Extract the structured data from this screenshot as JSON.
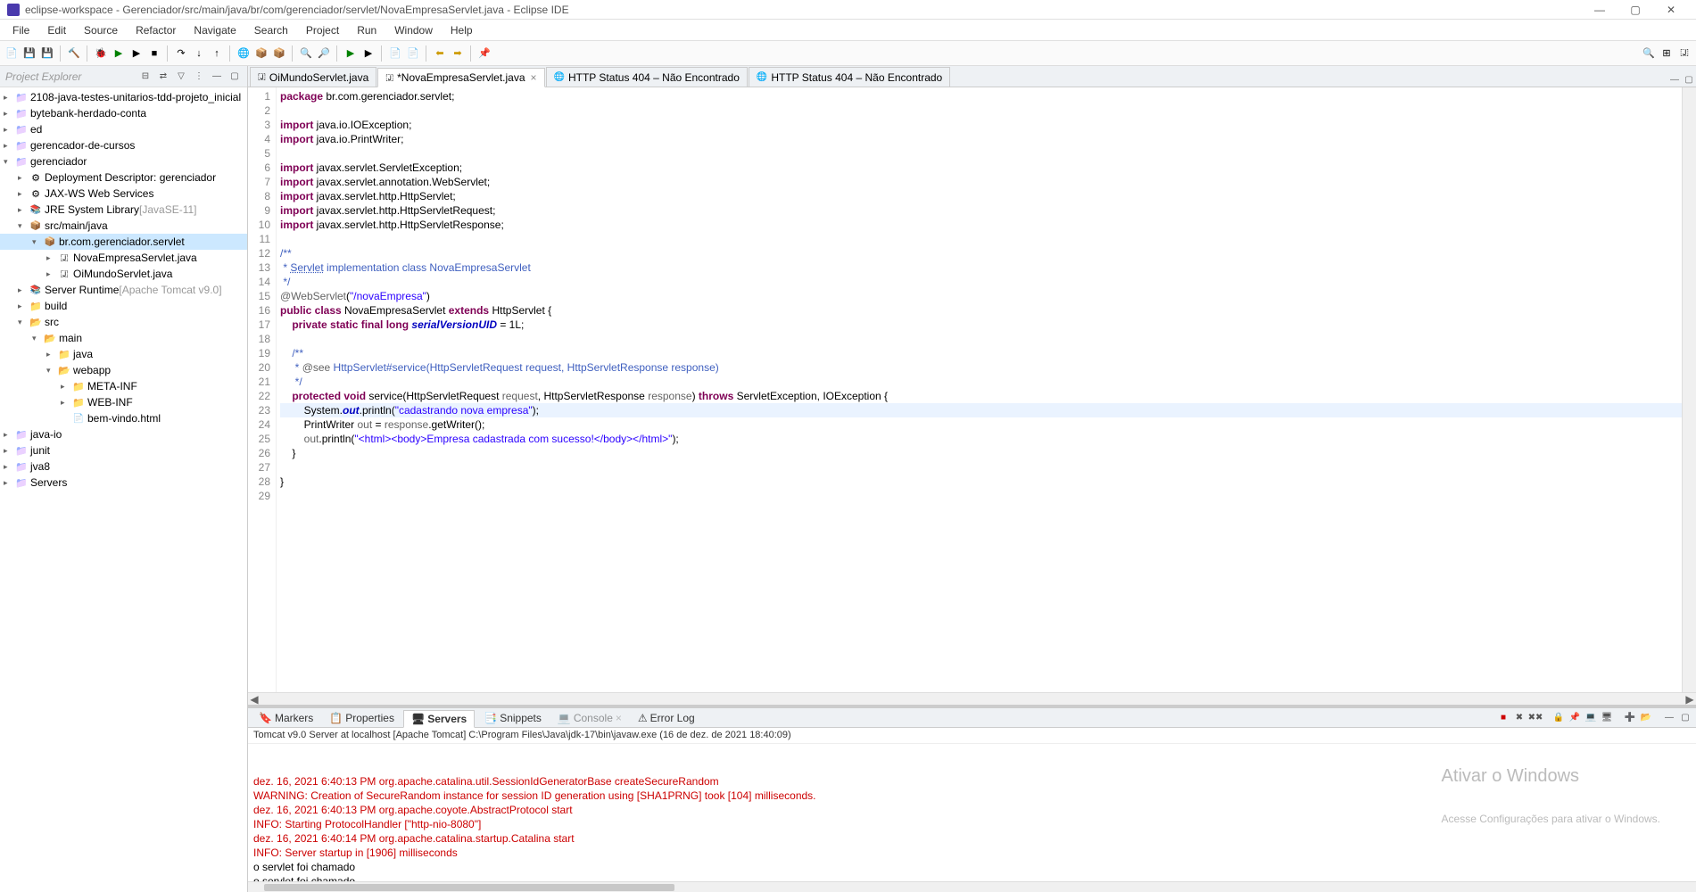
{
  "title": "eclipse-workspace - Gerenciador/src/main/java/br/com/gerenciador/servlet/NovaEmpresaServlet.java - Eclipse IDE",
  "menu": [
    "File",
    "Edit",
    "Source",
    "Refactor",
    "Navigate",
    "Search",
    "Project",
    "Run",
    "Window",
    "Help"
  ],
  "sidebar_title": "Project Explorer",
  "tree": [
    {
      "d": 0,
      "c": ">",
      "i": "proj",
      "t": "2108-java-testes-unitarios-tdd-projeto_inicial"
    },
    {
      "d": 0,
      "c": ">",
      "i": "proj",
      "t": "bytebank-herdado-conta"
    },
    {
      "d": 0,
      "c": ">",
      "i": "proj",
      "t": "ed"
    },
    {
      "d": 0,
      "c": ">",
      "i": "proj",
      "t": "gerencador-de-cursos"
    },
    {
      "d": 0,
      "c": "v",
      "i": "proj",
      "t": "gerenciador"
    },
    {
      "d": 1,
      "c": ">",
      "i": "gear",
      "t": "Deployment Descriptor: gerenciador"
    },
    {
      "d": 1,
      "c": ">",
      "i": "gear",
      "t": "JAX-WS Web Services"
    },
    {
      "d": 1,
      "c": ">",
      "i": "jar",
      "t": "JRE System Library",
      "suf": "[JavaSE-11]"
    },
    {
      "d": 1,
      "c": "v",
      "i": "pkg",
      "t": "src/main/java"
    },
    {
      "d": 2,
      "c": "v",
      "i": "pkg",
      "t": "br.com.gerenciador.servlet",
      "sel": true
    },
    {
      "d": 3,
      "c": ">",
      "i": "file-j",
      "t": "NovaEmpresaServlet.java"
    },
    {
      "d": 3,
      "c": ">",
      "i": "file-j",
      "t": "OiMundoServlet.java"
    },
    {
      "d": 1,
      "c": ">",
      "i": "jar",
      "t": "Server Runtime",
      "suf": "[Apache Tomcat v9.0]"
    },
    {
      "d": 1,
      "c": ">",
      "i": "folder-closed",
      "t": "build"
    },
    {
      "d": 1,
      "c": "v",
      "i": "folder-open",
      "t": "src"
    },
    {
      "d": 2,
      "c": "v",
      "i": "folder-open",
      "t": "main"
    },
    {
      "d": 3,
      "c": ">",
      "i": "folder-closed",
      "t": "java"
    },
    {
      "d": 3,
      "c": "v",
      "i": "folder-open",
      "t": "webapp"
    },
    {
      "d": 4,
      "c": ">",
      "i": "folder-closed",
      "t": "META-INF"
    },
    {
      "d": 4,
      "c": ">",
      "i": "folder-closed",
      "t": "WEB-INF"
    },
    {
      "d": 4,
      "c": " ",
      "i": "file-html",
      "t": "bem-vindo.html"
    },
    {
      "d": 0,
      "c": ">",
      "i": "proj",
      "t": "java-io"
    },
    {
      "d": 0,
      "c": ">",
      "i": "proj",
      "t": "junit"
    },
    {
      "d": 0,
      "c": ">",
      "i": "proj",
      "t": "jva8"
    },
    {
      "d": 0,
      "c": ">",
      "i": "proj",
      "t": "Servers"
    }
  ],
  "editor_tabs": [
    {
      "icon": "🇯",
      "label": "OiMundoServlet.java",
      "active": false
    },
    {
      "icon": "🇯",
      "label": "*NovaEmpresaServlet.java",
      "active": true,
      "close": true
    },
    {
      "icon": "🌐",
      "label": "HTTP Status 404 – Não Encontrado",
      "active": false
    },
    {
      "icon": "🌐",
      "label": "HTTP Status 404 – Não Encontrado",
      "active": false
    }
  ],
  "code_lines": [
    {
      "n": 1,
      "seg": [
        [
          "kw",
          "package"
        ],
        [
          "",
          " br.com.gerenciador.servlet;"
        ]
      ]
    },
    {
      "n": 2,
      "seg": []
    },
    {
      "n": 3,
      "seg": [
        [
          "kw",
          "import"
        ],
        [
          "",
          " java.io.IOException;"
        ]
      ]
    },
    {
      "n": 4,
      "seg": [
        [
          "kw",
          "import"
        ],
        [
          "",
          " java.io.PrintWriter;"
        ]
      ]
    },
    {
      "n": 5,
      "seg": []
    },
    {
      "n": 6,
      "seg": [
        [
          "kw",
          "import"
        ],
        [
          "",
          " javax.servlet.ServletException;"
        ]
      ]
    },
    {
      "n": 7,
      "seg": [
        [
          "kw",
          "import"
        ],
        [
          "",
          " javax.servlet.annotation.WebServlet;"
        ]
      ]
    },
    {
      "n": 8,
      "seg": [
        [
          "kw",
          "import"
        ],
        [
          "",
          " javax.servlet.http.HttpServlet;"
        ]
      ]
    },
    {
      "n": 9,
      "seg": [
        [
          "kw",
          "import"
        ],
        [
          "",
          " javax.servlet.http.HttpServletRequest;"
        ]
      ]
    },
    {
      "n": 10,
      "seg": [
        [
          "kw",
          "import"
        ],
        [
          "",
          " javax.servlet.http.HttpServletResponse;"
        ]
      ]
    },
    {
      "n": 11,
      "seg": []
    },
    {
      "n": 12,
      "seg": [
        [
          "cmt",
          "/**"
        ]
      ]
    },
    {
      "n": 13,
      "seg": [
        [
          "cmt",
          " * "
        ],
        [
          "cmt underl",
          "Servlet"
        ],
        [
          "cmt",
          " implementation class NovaEmpresaServlet"
        ]
      ]
    },
    {
      "n": 14,
      "seg": [
        [
          "cmt",
          " */"
        ]
      ]
    },
    {
      "n": 15,
      "seg": [
        [
          "ann",
          "@WebServlet"
        ],
        [
          "",
          "("
        ],
        [
          "str",
          "\"/novaEmpresa\""
        ],
        [
          "",
          ")"
        ]
      ]
    },
    {
      "n": 16,
      "seg": [
        [
          "kw",
          "public class"
        ],
        [
          "",
          " NovaEmpresaServlet "
        ],
        [
          "kw",
          "extends"
        ],
        [
          "",
          " HttpServlet {"
        ]
      ]
    },
    {
      "n": 17,
      "seg": [
        [
          "",
          "    "
        ],
        [
          "kw",
          "private static final long"
        ],
        [
          "",
          " "
        ],
        [
          "static-fld",
          "serialVersionUID"
        ],
        [
          "",
          " = 1L;"
        ]
      ]
    },
    {
      "n": 18,
      "seg": []
    },
    {
      "n": 19,
      "seg": [
        [
          "",
          "    "
        ],
        [
          "cmt",
          "/**"
        ]
      ]
    },
    {
      "n": 20,
      "seg": [
        [
          "",
          "    "
        ],
        [
          "cmt",
          " * "
        ],
        [
          "ann",
          "@see"
        ],
        [
          "cmt",
          " HttpServlet#service(HttpServletRequest request, HttpServletResponse response)"
        ]
      ]
    },
    {
      "n": 21,
      "seg": [
        [
          "",
          "    "
        ],
        [
          "cmt",
          " */"
        ]
      ]
    },
    {
      "n": 22,
      "seg": [
        [
          "",
          "    "
        ],
        [
          "kw",
          "protected void"
        ],
        [
          "",
          " service(HttpServletRequest "
        ],
        [
          "ann",
          "request"
        ],
        [
          "",
          ", HttpServletResponse "
        ],
        [
          "ann",
          "response"
        ],
        [
          "",
          ") "
        ],
        [
          "kw",
          "throws"
        ],
        [
          "",
          " ServletException, IOException {"
        ]
      ]
    },
    {
      "n": 23,
      "hl": true,
      "seg": [
        [
          "",
          "        System."
        ],
        [
          "static-fld",
          "out"
        ],
        [
          "",
          ".println("
        ],
        [
          "str",
          "\"cadastrando nova empresa\""
        ],
        [
          "",
          ");"
        ]
      ]
    },
    {
      "n": 24,
      "seg": [
        [
          "",
          "        PrintWriter "
        ],
        [
          "ann",
          "out"
        ],
        [
          "",
          " = "
        ],
        [
          "ann",
          "response"
        ],
        [
          "",
          ".getWriter();"
        ]
      ]
    },
    {
      "n": 25,
      "seg": [
        [
          "",
          "        "
        ],
        [
          "ann",
          "out"
        ],
        [
          "",
          ".println("
        ],
        [
          "str",
          "\"<html><body>Empresa cadastrada com sucesso!</body></html>\""
        ],
        [
          "",
          ");"
        ]
      ]
    },
    {
      "n": 26,
      "seg": [
        [
          "",
          "    }"
        ]
      ]
    },
    {
      "n": 27,
      "seg": []
    },
    {
      "n": 28,
      "seg": [
        [
          "",
          "}"
        ]
      ]
    },
    {
      "n": 29,
      "seg": []
    }
  ],
  "bottom_tabs": [
    {
      "icon": "🔖",
      "label": "Markers"
    },
    {
      "icon": "📋",
      "label": "Properties"
    },
    {
      "icon": "🖥",
      "label": "Servers",
      "active": true
    },
    {
      "icon": "📑",
      "label": "Snippets"
    },
    {
      "icon": "💻",
      "label": "Console",
      "faded": true,
      "close": true
    },
    {
      "icon": "⚠",
      "label": "Error Log"
    }
  ],
  "console_info": "Tomcat v9.0 Server at localhost [Apache Tomcat] C:\\Program Files\\Java\\jdk-17\\bin\\javaw.exe  (16 de dez. de 2021 18:40:09)",
  "console_lines": [
    {
      "c": "red",
      "t": "dez. 16, 2021 6:40:13 PM org.apache.catalina.util.SessionIdGeneratorBase createSecureRandom"
    },
    {
      "c": "red",
      "t": "WARNING: Creation of SecureRandom instance for session ID generation using [SHA1PRNG] took [104] milliseconds."
    },
    {
      "c": "red",
      "t": "dez. 16, 2021 6:40:13 PM org.apache.coyote.AbstractProtocol start"
    },
    {
      "c": "red",
      "t": "INFO: Starting ProtocolHandler [\"http-nio-8080\"]"
    },
    {
      "c": "red",
      "t": "dez. 16, 2021 6:40:14 PM org.apache.catalina.startup.Catalina start"
    },
    {
      "c": "red",
      "t": "INFO: Server startup in [1906] milliseconds"
    },
    {
      "c": "",
      "t": "o servlet foi chamado"
    },
    {
      "c": "",
      "t": "o servlet foi chamado"
    }
  ],
  "watermark": {
    "title": "Ativar o Windows",
    "sub": "Acesse Configurações para ativar o Windows."
  }
}
